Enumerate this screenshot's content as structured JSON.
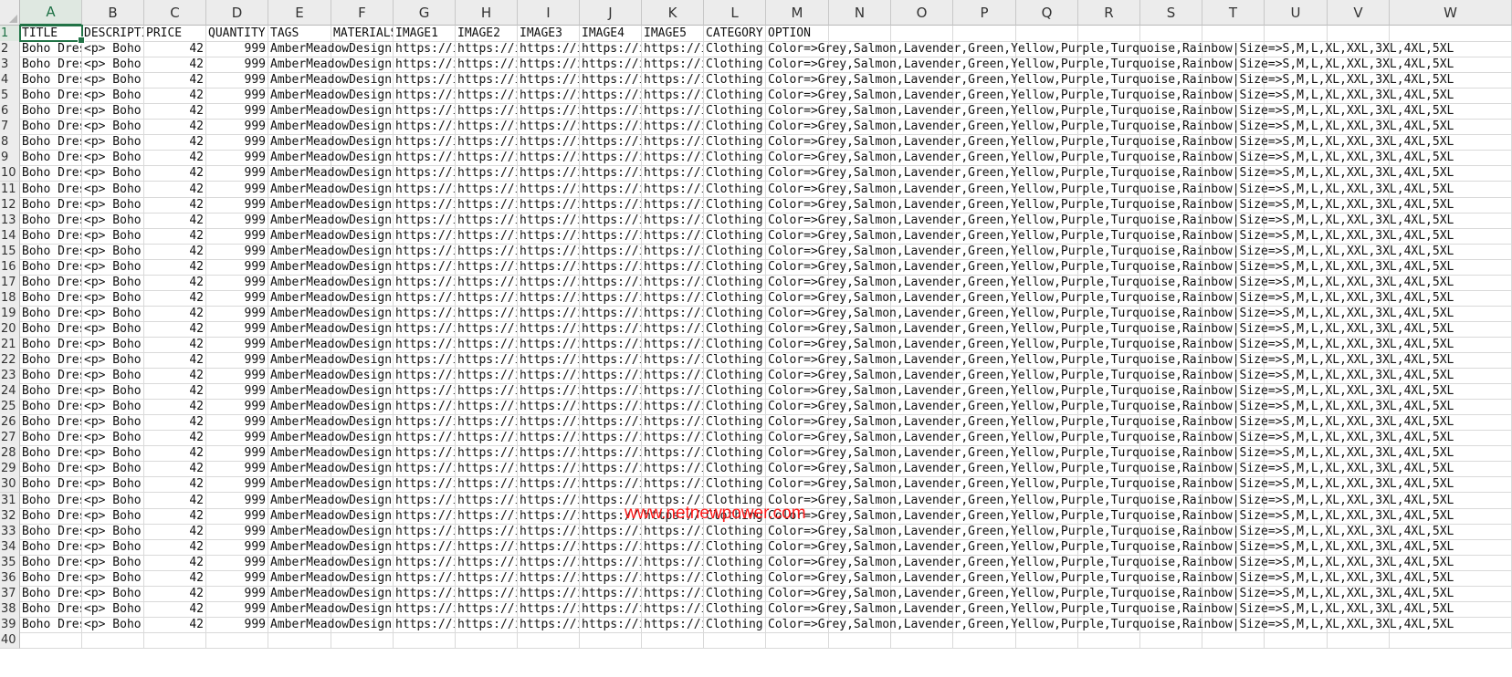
{
  "columns": [
    "A",
    "B",
    "C",
    "D",
    "E",
    "F",
    "G",
    "H",
    "I",
    "J",
    "K",
    "L",
    "M",
    "N",
    "O",
    "P",
    "Q",
    "R",
    "S",
    "T",
    "U",
    "V",
    "W"
  ],
  "active_column": "A",
  "active_row": 1,
  "row_numbers": [
    1,
    2,
    3,
    4,
    5,
    6,
    7,
    8,
    9,
    10,
    11,
    12,
    13,
    14,
    15,
    16,
    17,
    18,
    19,
    20,
    21,
    22,
    23,
    24,
    25,
    26,
    27,
    28,
    29,
    30,
    31,
    32,
    33,
    34,
    35,
    36,
    37,
    38,
    39,
    40
  ],
  "header_row": {
    "A": "TITLE",
    "B": "DESCRIPTION",
    "C": "PRICE",
    "D": "QUANTITY",
    "E": "TAGS",
    "F": "MATERIALS",
    "G": "IMAGE1",
    "H": "IMAGE2",
    "I": "IMAGE3",
    "J": "IMAGE4",
    "K": "IMAGE5",
    "L": "CATEGORY",
    "M": "OPTION"
  },
  "data_row": {
    "A": "Boho Dress",
    "B": "<p> Boho",
    "C": "42",
    "D": "999",
    "E": "AmberMeadowDesign",
    "F": "",
    "G": "https://ih",
    "H": "https://ih",
    "I": "https://ih",
    "J": "https://ih",
    "K": "https://i",
    "L": "Clothing",
    "M": "Color=>Grey,Salmon,Lavender,Green,Yellow,Purple,Turquoise,Rainbow|Size=>S,M,L,XL,XXL,3XL,4XL,5XL"
  },
  "data_row_count": 38,
  "watermark": "www.netnewpower.com",
  "colors": {
    "accent": "#217346",
    "header_bg": "#ececec",
    "gridline": "#d9d9d9",
    "watermark": "#ff1a1a"
  }
}
